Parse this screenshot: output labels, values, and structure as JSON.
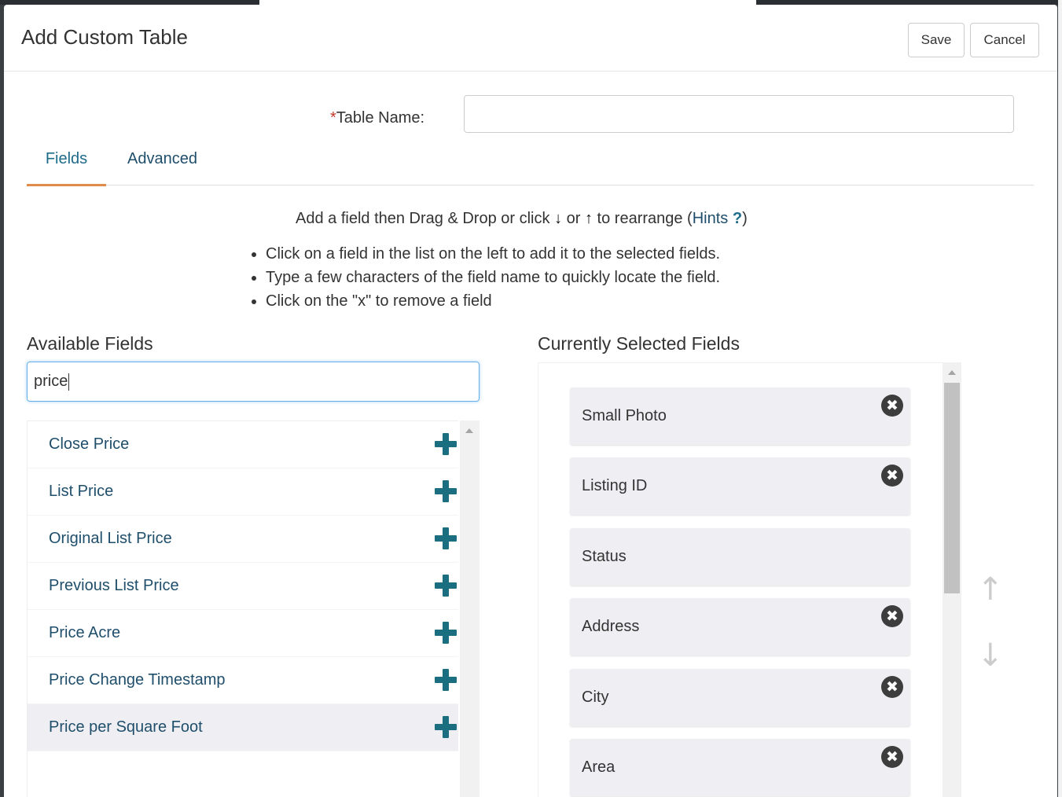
{
  "modal": {
    "title": "Add Custom Table",
    "save_label": "Save",
    "cancel_label": "Cancel"
  },
  "table_name": {
    "required_mark": "*",
    "label": "Table Name:",
    "value": ""
  },
  "tabs": [
    {
      "label": "Fields",
      "active": true
    },
    {
      "label": "Advanced",
      "active": false
    }
  ],
  "hint": {
    "text_before": "Add a field then Drag & Drop or click",
    "arrow_down": "↓",
    "or": "or",
    "arrow_up": "↑",
    "text_after": "to rearrange (",
    "hints_link": "Hints",
    "hints_icon": "?",
    "close_paren": ")"
  },
  "bullets": [
    "Click on a field in the list on the left to add it to the selected fields.",
    "Type a few characters of the field name to quickly locate the field.",
    "Click on the \"x\" to remove a field"
  ],
  "available": {
    "title": "Available Fields",
    "search_value": "price",
    "items": [
      "Close Price",
      "List Price",
      "Original List Price",
      "Previous List Price",
      "Price Acre",
      "Price Change Timestamp",
      "Price per Square Foot"
    ],
    "highlighted_index": 6,
    "add_icon": "plus-icon"
  },
  "selected": {
    "title": "Currently Selected Fields",
    "items": [
      {
        "label": "Small Photo",
        "removable": true
      },
      {
        "label": "Listing ID",
        "removable": true
      },
      {
        "label": "Status",
        "removable": false
      },
      {
        "label": "Address",
        "removable": true
      },
      {
        "label": "City",
        "removable": true
      },
      {
        "label": "Area",
        "removable": true
      }
    ],
    "remove_glyph": "✖",
    "move_up_glyph": "↑",
    "move_down_glyph": "↓"
  },
  "colors": {
    "accent_tab_underline": "#e08b4a",
    "link": "#1f4e6b",
    "plus": "#1a6e80"
  }
}
